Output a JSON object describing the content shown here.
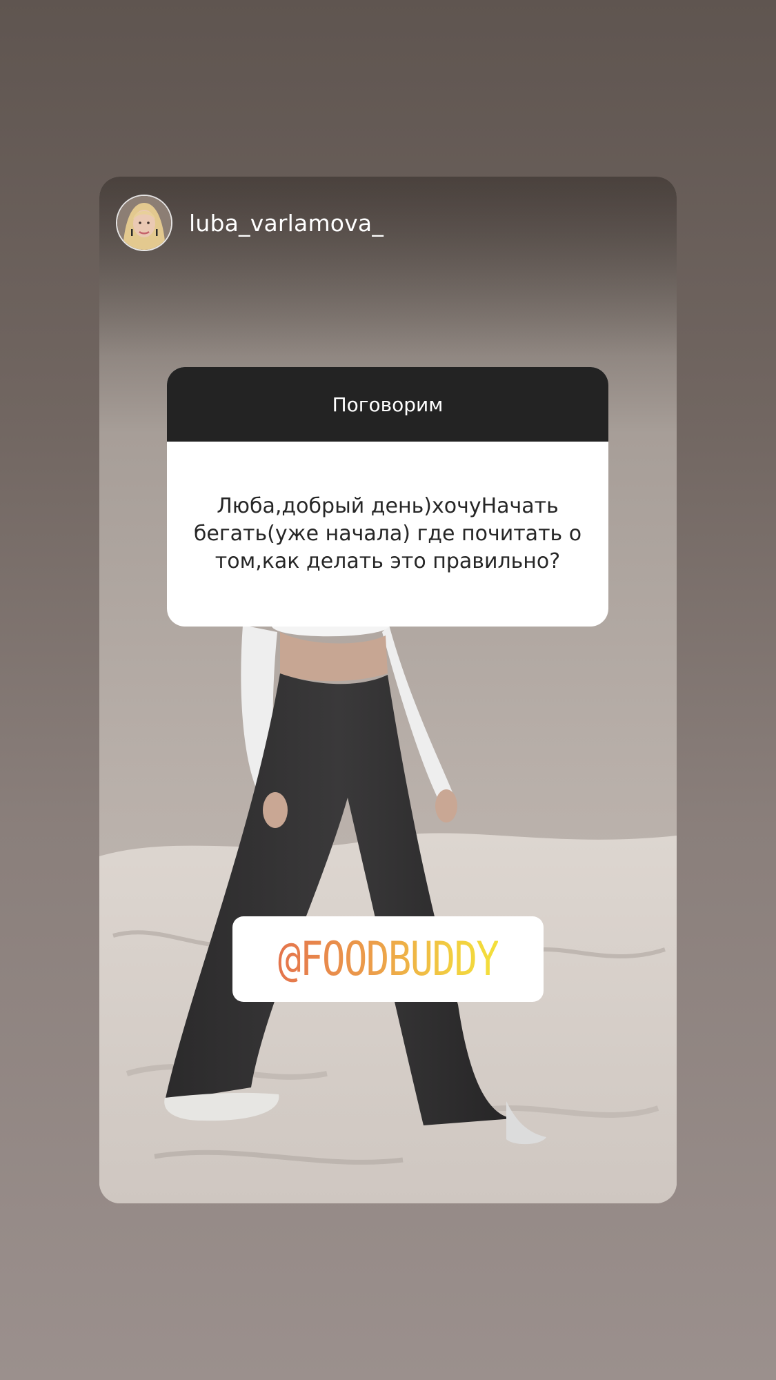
{
  "story": {
    "author": {
      "username": "luba_varlamova_",
      "avatar_icon": "profile-photo"
    },
    "question_sticker": {
      "title": "Поговорим",
      "text": "Люба,добрый день)хочуНачать бегать(уже начала) где почитать о том,как делать это правильно?"
    },
    "mention_sticker": {
      "text": "@FOODBUDDY",
      "gradient": [
        "#e4744c",
        "#eca04a",
        "#f2cf40",
        "#f3e03a"
      ]
    }
  },
  "colors": {
    "backdrop": "#716661",
    "question_header": "#232323",
    "text_dark": "#262626"
  }
}
